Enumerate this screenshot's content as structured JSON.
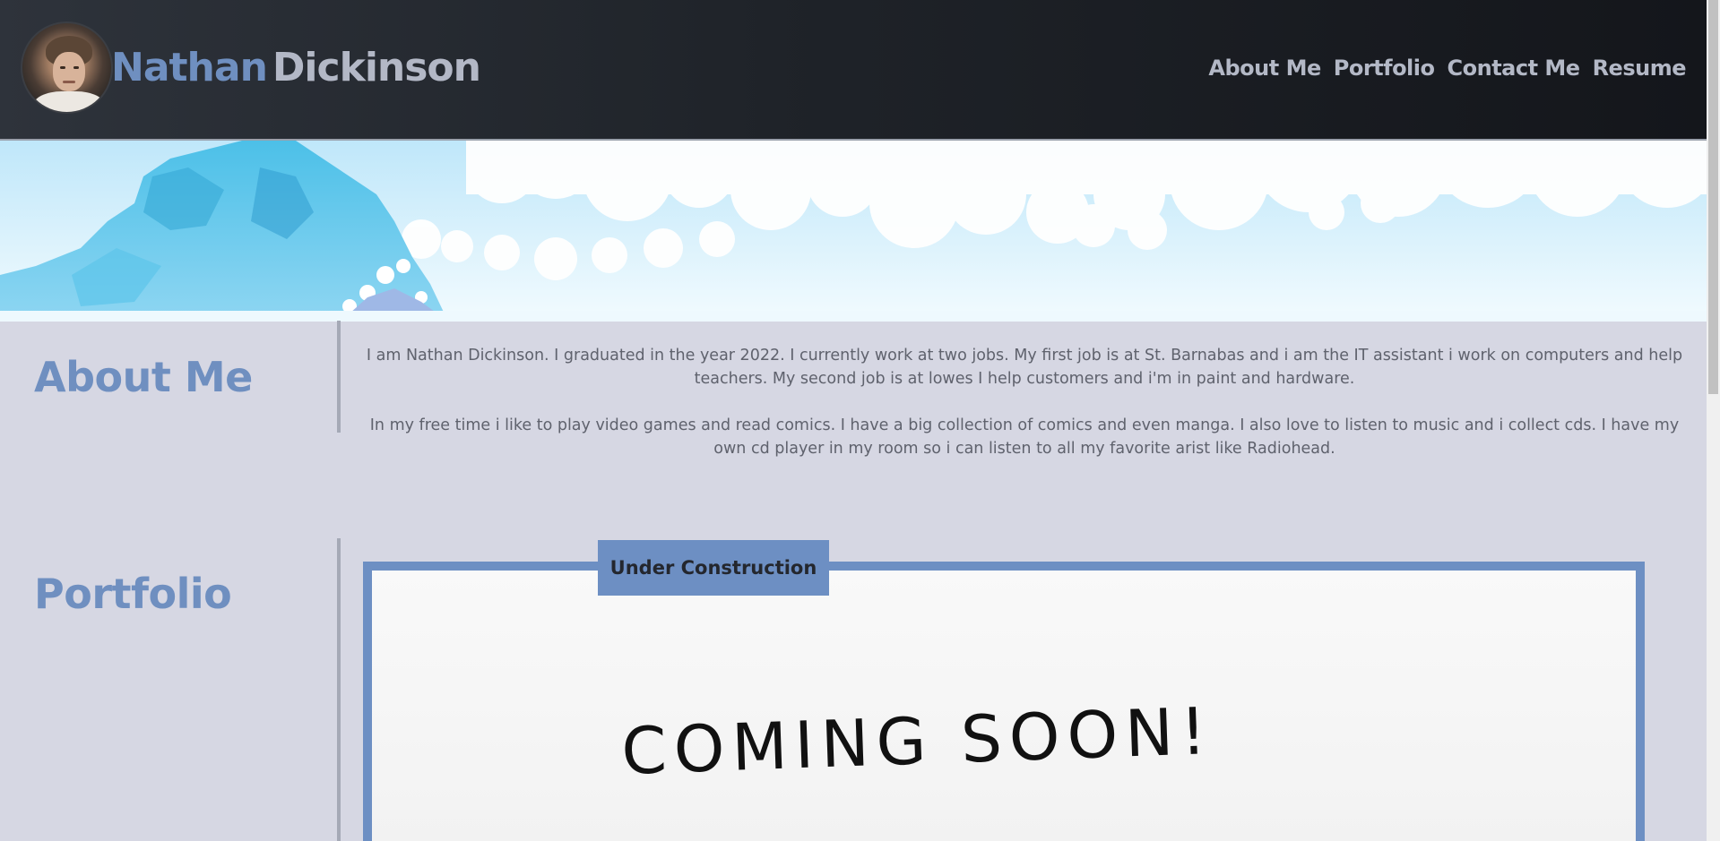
{
  "header": {
    "name_first": "Nathan",
    "name_last": "Dickinson",
    "avatar_alt": "profile photo",
    "nav": [
      {
        "label": "About Me"
      },
      {
        "label": "Portfolio"
      },
      {
        "label": "Contact Me"
      },
      {
        "label": "Resume"
      }
    ]
  },
  "about": {
    "title": "About Me",
    "paragraphs": [
      "I am Nathan Dickinson. I graduated in the year 2022. I currently work at two jobs. My first job is at St. Barnabas and i am the IT assistant i work on computers and help teachers. My second job is at lowes I help customers and i'm in paint and hardware.",
      "In my free time i like to play video games and read comics. I have a big collection of comics and even manga. I also love to listen to music and i collect cds. I have my own cd player in my room so i can listen to all my favorite arist like Radiohead."
    ]
  },
  "portfolio": {
    "title": "Portfolio",
    "badge": "Under Construction",
    "image_text": "COMING SOON!"
  },
  "colors": {
    "accent": "#6f8fc0",
    "header_bg": "#1f2329",
    "page_bg": "#d6d7e3",
    "text": "#5f626d"
  }
}
